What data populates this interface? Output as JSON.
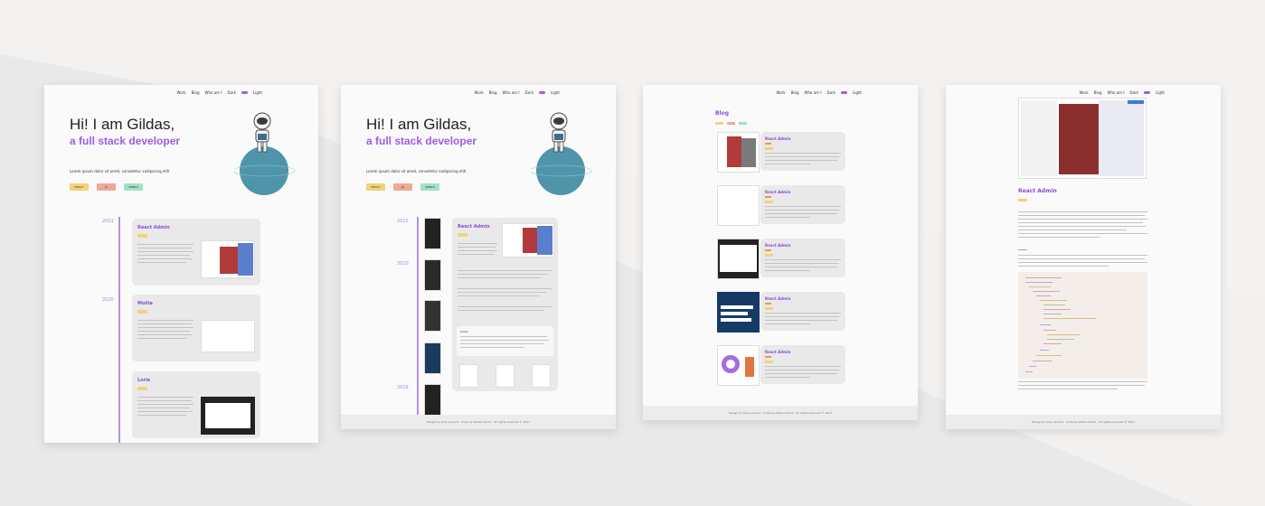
{
  "colors": {
    "accent": "#9b5de5",
    "react": "#f3d27a",
    "js": "#f0a795",
    "webcomponents": "#9fe3c5",
    "card": "#e9e9e9"
  },
  "nav": {
    "items": [
      "Work",
      "Blog",
      "Who am I",
      "Dark",
      "Light"
    ]
  },
  "hero": {
    "title": "Hi! I am Gildas,",
    "subtitle": "a full stack developer",
    "lorem": "Lorem ipsum dolor sit amet, consetetur sadipscing elitr",
    "tags": [
      "REACT",
      "JS",
      "WEBCS"
    ]
  },
  "timeline1": {
    "years": [
      "2021",
      "2020"
    ],
    "cards": [
      "React Admin",
      "Mollia",
      "Lorie"
    ]
  },
  "timeline2": {
    "years": [
      "2021",
      "2020",
      "2019"
    ],
    "card_title": "React Admin",
    "sub_card": "Lorie"
  },
  "blog": {
    "title": "Blog",
    "posts": [
      "React Admin",
      "React Admin",
      "React Admin",
      "React Admin",
      "React Admin"
    ]
  },
  "article": {
    "title": "React Admin"
  },
  "footer": {
    "text": "Design by Amy Laurent · Code by Gildas Garcia · All rights reserved © 2021"
  }
}
